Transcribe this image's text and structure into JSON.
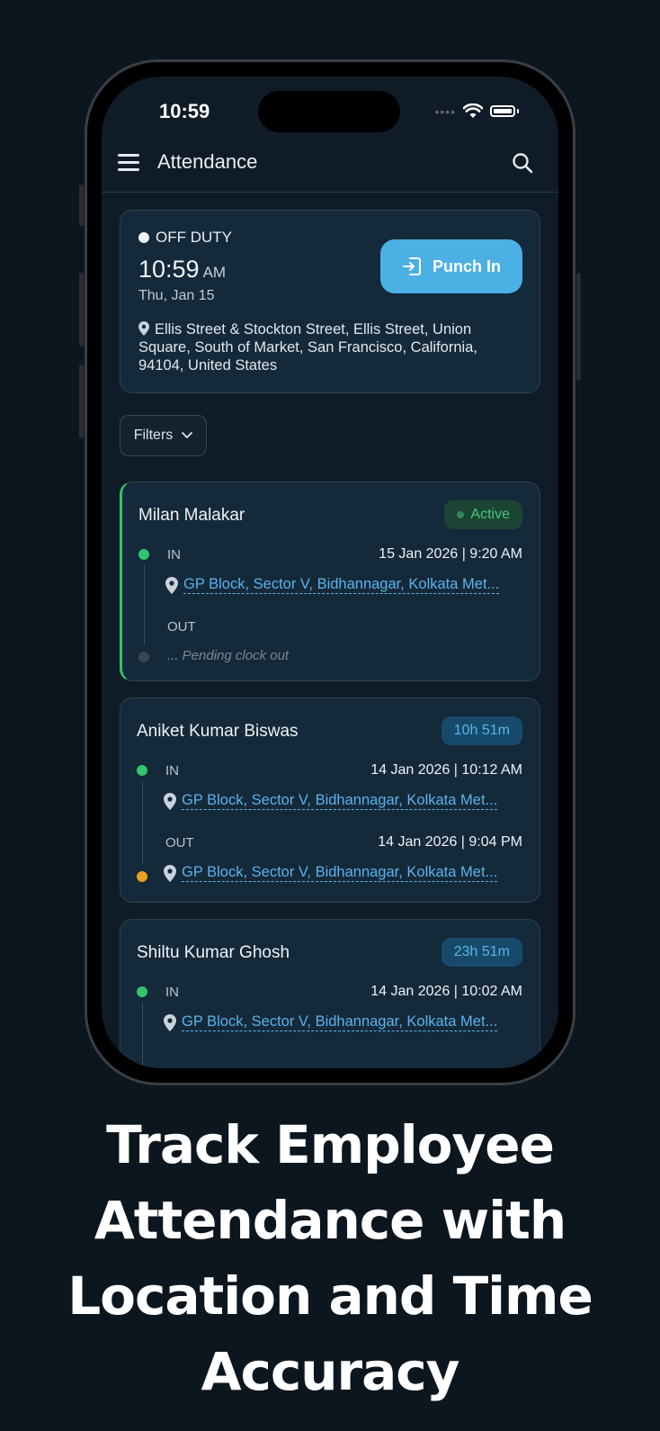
{
  "status_bar": {
    "time": "10:59"
  },
  "appbar": {
    "title": "Attendance"
  },
  "duty": {
    "status": "OFF DUTY",
    "time": "10:59",
    "ampm": "AM",
    "date": "Thu, Jan 15",
    "address": "Ellis Street & Stockton Street, Ellis Street, Union Square, South of Market, San Francisco, California, 94104, United States",
    "punch_label": "Punch In"
  },
  "filters": {
    "label": "Filters"
  },
  "records": [
    {
      "name": "Milan Malakar",
      "badge": "Active",
      "in_label": "IN",
      "in_time": "15 Jan 2026 | 9:20 AM",
      "in_location": "GP Block, Sector V, Bidhannagar, Kolkata Met...",
      "out_label": "OUT",
      "pending": "... Pending clock out"
    },
    {
      "name": "Aniket Kumar Biswas",
      "badge": "10h 51m",
      "in_label": "IN",
      "in_time": "14 Jan 2026 | 10:12 AM",
      "in_location": "GP Block, Sector V, Bidhannagar, Kolkata Met...",
      "out_label": "OUT",
      "out_time": "14 Jan 2026 | 9:04 PM",
      "out_location": "GP Block, Sector V, Bidhannagar, Kolkata Met..."
    },
    {
      "name": "Shiltu Kumar Ghosh",
      "badge": "23h 51m",
      "in_label": "IN",
      "in_time": "14 Jan 2026 | 10:02 AM",
      "in_location": "GP Block, Sector V, Bidhannagar, Kolkata Met..."
    }
  ],
  "tagline": [
    "Track Employee",
    "Attendance with",
    "Location and Time",
    "Accuracy"
  ],
  "colors": {
    "background": "#0c161f",
    "accent": "#4bb0e4",
    "active": "#33c26d",
    "pending_out": "#e6a21e"
  },
  "icons": [
    "menu-icon",
    "search-icon",
    "punch-in-icon",
    "location-pin-icon",
    "chevron-down-icon",
    "wifi-icon",
    "battery-icon"
  ]
}
